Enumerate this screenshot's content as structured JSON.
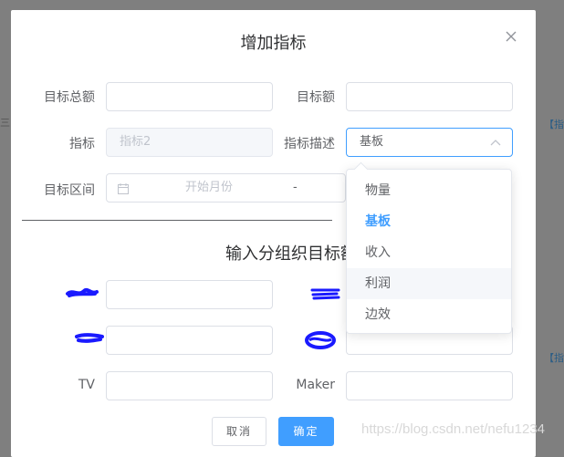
{
  "background": {
    "right_link_top": "【指",
    "right_link_bottom": "【指",
    "left_mark": "三"
  },
  "dialog": {
    "title": "增加指标",
    "close_icon": "close-icon"
  },
  "form": {
    "target_total_label": "目标总额",
    "target_total_value": "",
    "target_amount_label": "目标额",
    "target_amount_value": "",
    "indicator_label": "指标",
    "indicator_value": "指标2",
    "indicator_desc_label": "指标描述",
    "indicator_desc_value": "基板",
    "target_range_label": "目标区间",
    "start_month_placeholder": "开始月份",
    "range_separator": "-"
  },
  "section": {
    "title": "输入分组织目标额"
  },
  "groups": {
    "tv_label": "TV",
    "tv_value": "",
    "maker_label": "Maker",
    "maker_value": ""
  },
  "dropdown": {
    "options": [
      "物量",
      "基板",
      "收入",
      "利润",
      "边效"
    ],
    "selected": "基板",
    "hovered": "利润"
  },
  "buttons": {
    "cancel": "取消",
    "ok": "确定"
  },
  "watermark": "https://blog.csdn.net/nefu1234",
  "colors": {
    "primary": "#409eff",
    "overlay": "#7f7f7f",
    "scribble": "#1a1aff"
  }
}
